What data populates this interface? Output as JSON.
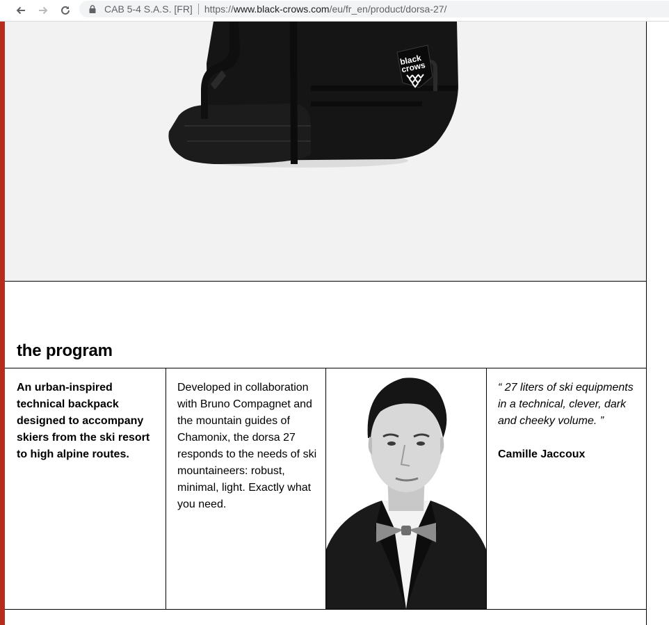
{
  "browser": {
    "site_identity": "CAB 5-4 S.A.S. [FR]",
    "url_scheme": "https://",
    "url_host": "www.black-crows.com",
    "url_path": "/eu/fr_en/product/dorsa-27/"
  },
  "hero": {
    "brand_patch": [
      "black",
      "crows"
    ]
  },
  "program": {
    "title": "the program",
    "intro": "An urban-inspired technical backpack designed to accompany skiers from the ski resort to high alpine routes.",
    "body": "Developed in collaboration with Bruno Compagnet and the mountain guides of Chamonix, the dorsa 27 responds to the needs of ski mountaineers: robust, minimal, light. Exactly what you need.",
    "quote": "“ 27 liters of ski equipments in a technical, clever, dark and cheeky volume. ”",
    "quote_author": "Camille Jaccoux"
  },
  "colors": {
    "accent_bar": "#b42d1f",
    "hero_bg": "#f2f2f2",
    "rule": "#000000"
  },
  "icons": [
    "back-arrow-icon",
    "forward-arrow-icon",
    "reload-icon",
    "lock-icon"
  ]
}
